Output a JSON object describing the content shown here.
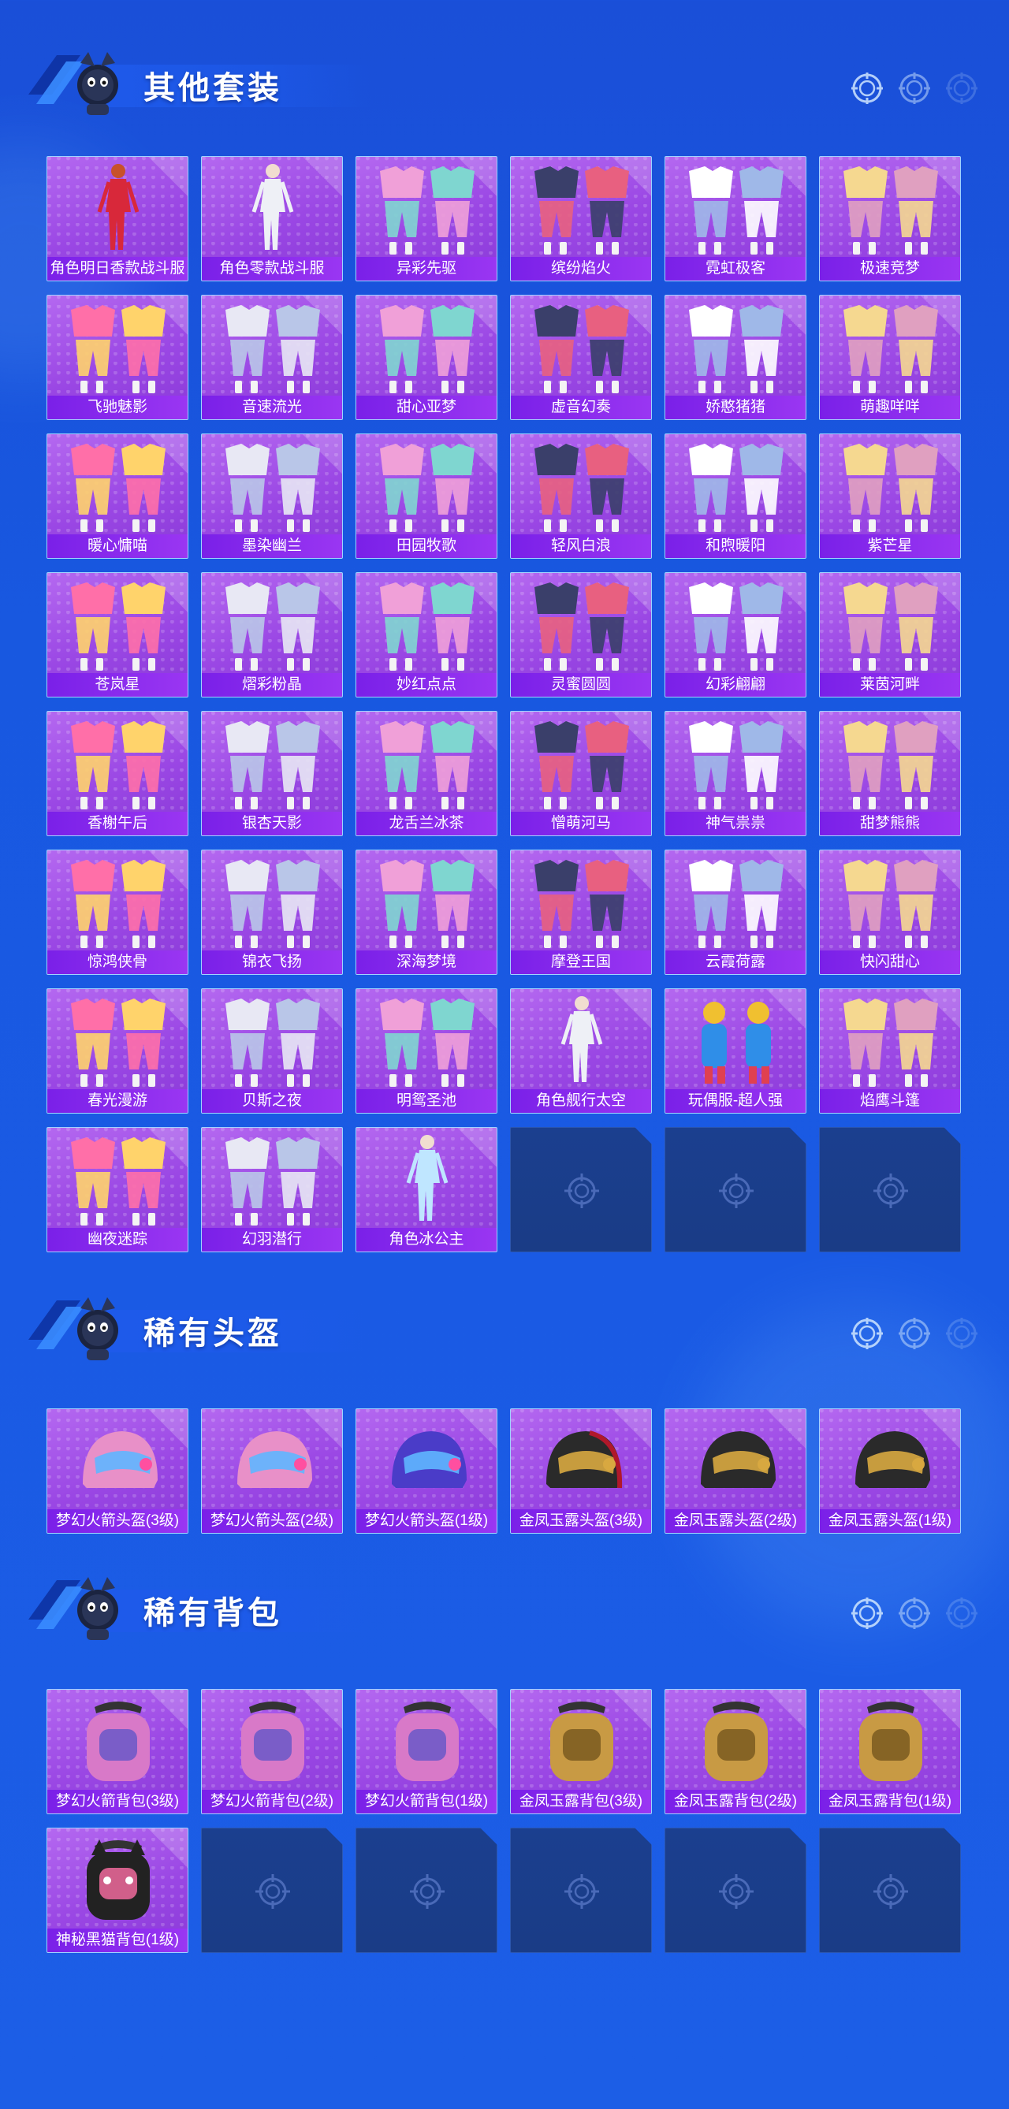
{
  "sections": [
    {
      "title": "其他套装",
      "items": [
        {
          "label": "角色明日香款战斗服",
          "icon": "character-red-suit"
        },
        {
          "label": "角色零款战斗服",
          "icon": "character-white-suit"
        },
        {
          "label": "异彩先驱",
          "icon": "outfit-set"
        },
        {
          "label": "缤纷焰火",
          "icon": "outfit-set"
        },
        {
          "label": "霓虹极客",
          "icon": "outfit-set"
        },
        {
          "label": "极速竞梦",
          "icon": "outfit-set"
        },
        {
          "label": "飞驰魅影",
          "icon": "outfit-set"
        },
        {
          "label": "音速流光",
          "icon": "outfit-set"
        },
        {
          "label": "甜心亚梦",
          "icon": "outfit-set"
        },
        {
          "label": "虚音幻奏",
          "icon": "outfit-set"
        },
        {
          "label": "娇憨猪猪",
          "icon": "outfit-set"
        },
        {
          "label": "萌趣咩咩",
          "icon": "outfit-set"
        },
        {
          "label": "暖心慵喵",
          "icon": "outfit-set"
        },
        {
          "label": "墨染幽兰",
          "icon": "outfit-set"
        },
        {
          "label": "田园牧歌",
          "icon": "outfit-set"
        },
        {
          "label": "轻风白浪",
          "icon": "outfit-set"
        },
        {
          "label": "和煦暖阳",
          "icon": "outfit-set"
        },
        {
          "label": "紫芒星",
          "icon": "outfit-set"
        },
        {
          "label": "苍岚星",
          "icon": "outfit-set"
        },
        {
          "label": "熠彩粉晶",
          "icon": "outfit-set"
        },
        {
          "label": "妙红点点",
          "icon": "outfit-set"
        },
        {
          "label": "灵蜜圆圆",
          "icon": "outfit-set"
        },
        {
          "label": "幻彩翩翩",
          "icon": "outfit-set"
        },
        {
          "label": "莱茵河畔",
          "icon": "outfit-set"
        },
        {
          "label": "香榭午后",
          "icon": "outfit-set"
        },
        {
          "label": "银杏天影",
          "icon": "outfit-set"
        },
        {
          "label": "龙舌兰冰茶",
          "icon": "outfit-set"
        },
        {
          "label": "憎萌河马",
          "icon": "outfit-set"
        },
        {
          "label": "神气祟祟",
          "icon": "outfit-set"
        },
        {
          "label": "甜梦熊熊",
          "icon": "outfit-set"
        },
        {
          "label": "惊鸿侠骨",
          "icon": "outfit-set"
        },
        {
          "label": "锦衣飞扬",
          "icon": "outfit-set"
        },
        {
          "label": "深海梦境",
          "icon": "outfit-set"
        },
        {
          "label": "摩登王国",
          "icon": "outfit-set"
        },
        {
          "label": "云霞荷露",
          "icon": "outfit-set"
        },
        {
          "label": "快闪甜心",
          "icon": "outfit-set"
        },
        {
          "label": "春光漫游",
          "icon": "outfit-set"
        },
        {
          "label": "贝斯之夜",
          "icon": "outfit-set"
        },
        {
          "label": "明鸳圣池",
          "icon": "outfit-set"
        },
        {
          "label": "角色舰行太空",
          "icon": "character-suit"
        },
        {
          "label": "玩偶服-超人强",
          "icon": "mascot-costume"
        },
        {
          "label": "焰鹰斗篷",
          "icon": "outfit-set"
        },
        {
          "label": "幽夜迷踪",
          "icon": "outfit-set"
        },
        {
          "label": "幻羽潜行",
          "icon": "outfit-set"
        },
        {
          "label": "角色冰公主",
          "icon": "character-dress"
        }
      ],
      "empty_slots": 3
    },
    {
      "title": "稀有头盔",
      "items": [
        {
          "label": "梦幻火箭头盔(3级)",
          "icon": "helmet-pink"
        },
        {
          "label": "梦幻火箭头盔(2级)",
          "icon": "helmet-pink"
        },
        {
          "label": "梦幻火箭头盔(1级)",
          "icon": "helmet-round"
        },
        {
          "label": "金凤玉露头盔(3级)",
          "icon": "helmet-gold"
        },
        {
          "label": "金凤玉露头盔(2级)",
          "icon": "helmet-gold"
        },
        {
          "label": "金凤玉露头盔(1级)",
          "icon": "helmet-gold"
        }
      ],
      "empty_slots": 0
    },
    {
      "title": "稀有背包",
      "items": [
        {
          "label": "梦幻火箭背包(3级)",
          "icon": "backpack-pink"
        },
        {
          "label": "梦幻火箭背包(2级)",
          "icon": "backpack-pink"
        },
        {
          "label": "梦幻火箭背包(1级)",
          "icon": "backpack-pink"
        },
        {
          "label": "金凤玉露背包(3级)",
          "icon": "backpack-gold"
        },
        {
          "label": "金凤玉露背包(2级)",
          "icon": "backpack-gold"
        },
        {
          "label": "金凤玉露背包(1级)",
          "icon": "backpack-gold"
        },
        {
          "label": "神秘黑猫背包(1级)",
          "icon": "backpack-cat"
        }
      ],
      "empty_slots": 5
    }
  ],
  "colors": {
    "background": "#1a55de",
    "card": "#a052e8",
    "label_bar": "#8a2cf0",
    "empty_slot": "#1b3f8f"
  }
}
